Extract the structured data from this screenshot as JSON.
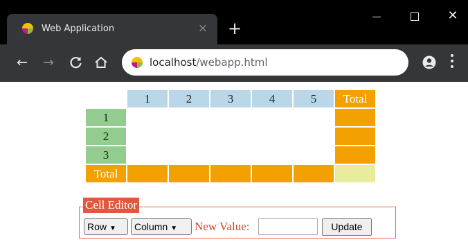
{
  "browser": {
    "tab_title": "Web Application",
    "tab_close": "×",
    "new_tab": "+",
    "url_host": "localhost",
    "url_path": "/webapp.html",
    "window_close": "✕"
  },
  "nav_icons": {
    "back": "←",
    "forward": "→",
    "reload": "C",
    "home": "⌂"
  },
  "grid": {
    "column_headers": [
      "1",
      "2",
      "3",
      "4",
      "5"
    ],
    "total_label": "Total",
    "row_headers": [
      "1",
      "2",
      "3"
    ],
    "row_total_label": "Total"
  },
  "editor": {
    "legend": "Cell Editor",
    "row_select": "Row",
    "column_select": "Column",
    "new_value_label": "New Value:",
    "new_value_input": "",
    "update_button": "Update",
    "select_arrow": "▼"
  },
  "colors": {
    "column_header": "#b9d7e8",
    "row_header": "#92cc8f",
    "total": "#f2a100",
    "grand_total": "#e8ec9c",
    "editor_accent": "#e2583a"
  }
}
